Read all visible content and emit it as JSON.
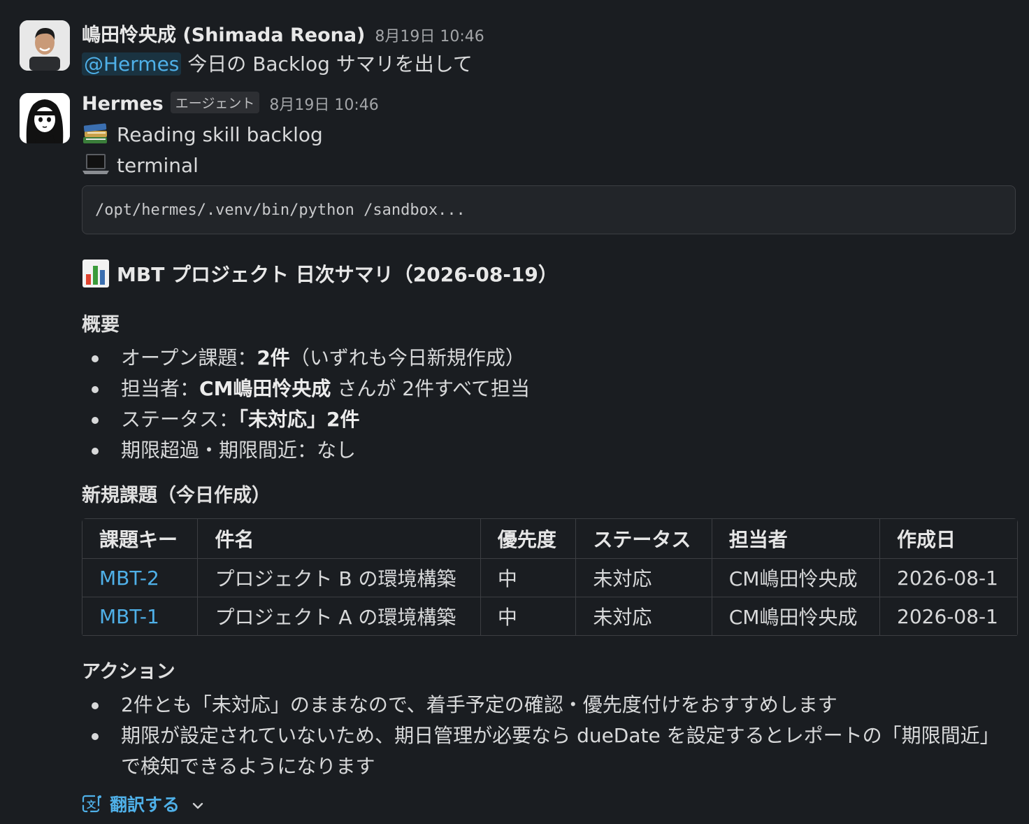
{
  "user_message": {
    "sender": "嶋田怜央成 (Shimada Reona)",
    "time": "8月19日 10:46",
    "mention": "@Hermes",
    "text": " 今日の Backlog サマリを出して"
  },
  "bot_message": {
    "sender": "Hermes",
    "badge": "エージェント",
    "time": "8月19日 10:46",
    "status_lines": [
      {
        "icon": "books-icon",
        "text": "Reading skill backlog"
      },
      {
        "icon": "laptop-icon",
        "text": "terminal"
      }
    ],
    "code": "/opt/hermes/.venv/bin/python /sandbox...",
    "title": "MBT プロジェクト 日次サマリ（2026-08-19）",
    "overview_heading": "概要",
    "overview": [
      {
        "label": "オープン課題：",
        "bold": "2件",
        "rest": "（いずれも今日新規作成）"
      },
      {
        "label": "担当者：",
        "bold": "CM嶋田怜央成",
        "rest": " さんが 2件すべて担当"
      },
      {
        "label": "ステータス：",
        "bold": "「未対応」2件",
        "rest": ""
      },
      {
        "label": "期限超過・期限間近：なし",
        "bold": "",
        "rest": ""
      }
    ],
    "new_issues_heading": "新規課題（今日作成）",
    "table": {
      "headers": [
        "課題キー",
        "件名",
        "優先度",
        "ステータス",
        "担当者",
        "作成日"
      ],
      "rows": [
        [
          "MBT-2",
          "プロジェクト B の環境構築",
          "中",
          "未対応",
          "CM嶋田怜央成",
          "2026-08-1"
        ],
        [
          "MBT-1",
          "プロジェクト A の環境構築",
          "中",
          "未対応",
          "CM嶋田怜央成",
          "2026-08-1"
        ]
      ]
    },
    "actions_heading": "アクション",
    "actions": [
      "2件とも「未対応」のままなので、着手予定の確認・優先度付けをおすすめします",
      "期限が設定されていないため、期日管理が必要なら dueDate を設定するとレポートの「期限間近」で検知できるようになります"
    ],
    "translate_label": "翻訳する"
  },
  "colors": {
    "background": "#1a1d21",
    "link": "#4fb0e8",
    "text": "#d8d9da"
  }
}
